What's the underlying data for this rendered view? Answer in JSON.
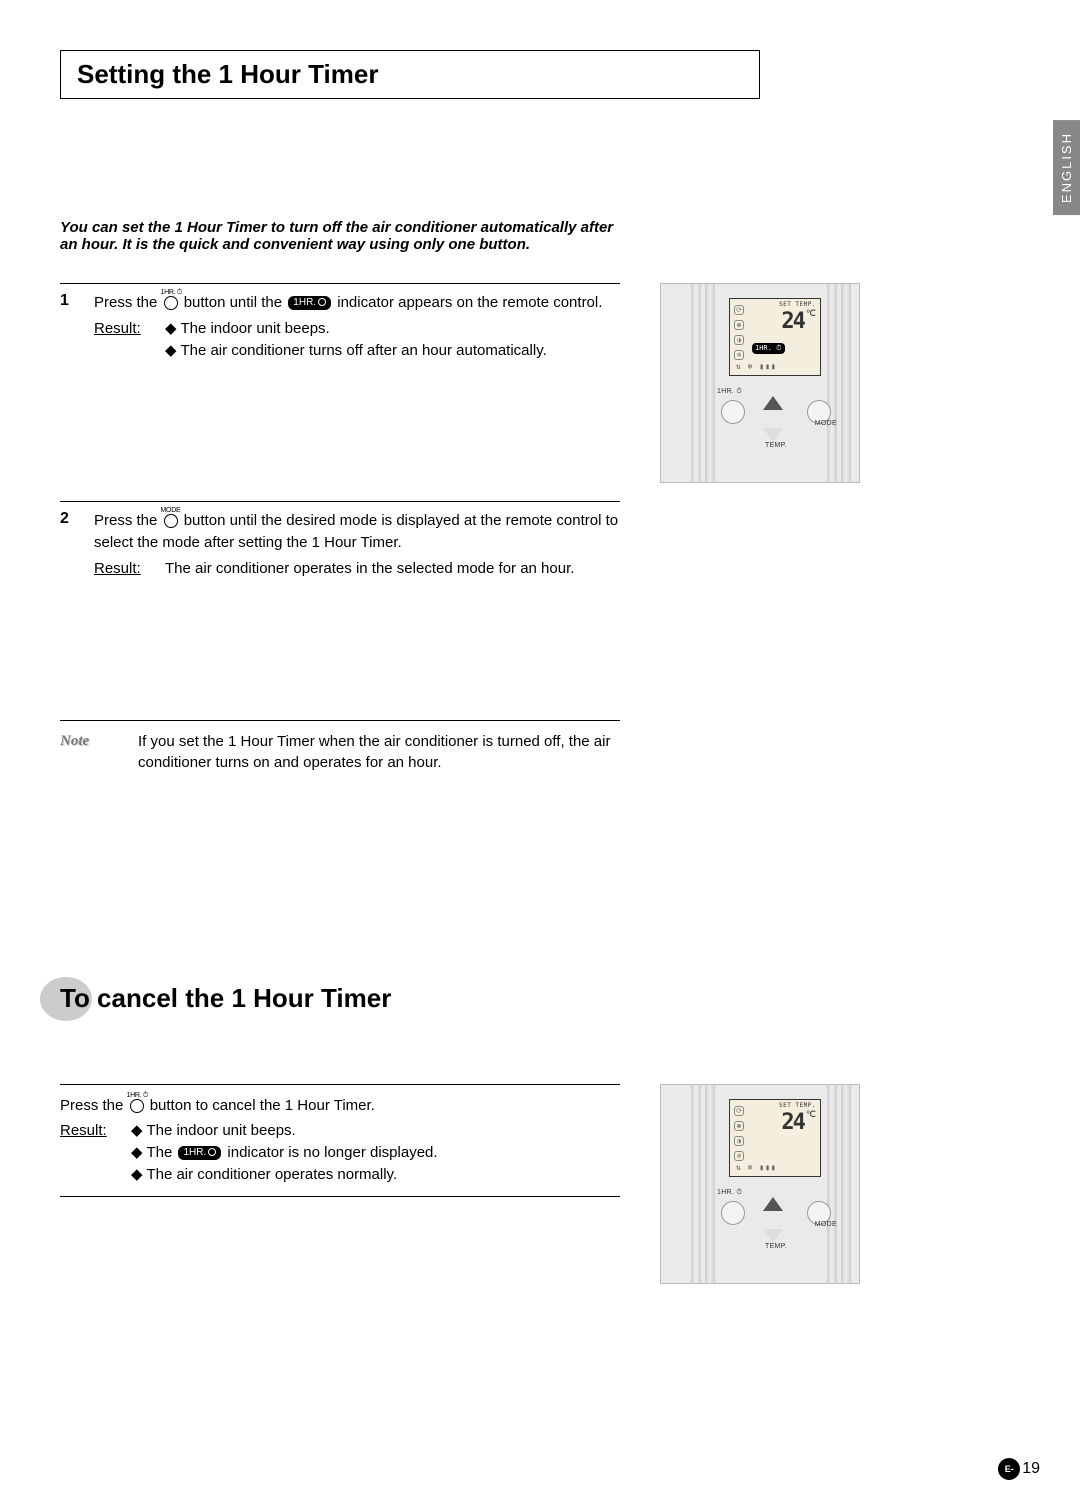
{
  "language_tab": "ENGLISH",
  "title": "Setting the 1 Hour Timer",
  "intro": "You can set the 1 Hour Timer to turn off the air conditioner automatically after an hour. It is the quick and convenient way using only one button.",
  "step1": {
    "num": "1",
    "btn_label": "1HR. ⏱",
    "badge": "1HR.",
    "text_before": "Press the ",
    "text_mid": " button until the ",
    "text_after": " indicator appears on the remote control.",
    "result_label": "Result:",
    "bullets": [
      "The indoor unit beeps.",
      "The air conditioner turns off after an hour automatically."
    ]
  },
  "step2": {
    "num": "2",
    "btn_label": "MODE",
    "text_before": "Press the ",
    "text_after": " button until the desired mode is displayed at the remote control to select the mode after setting the 1 Hour Timer.",
    "result_label": "Result:",
    "result_text": "The air conditioner operates in the selected mode for an hour."
  },
  "note": {
    "label": "Note",
    "text": "If you set the 1 Hour Timer when the air conditioner is turned off, the air conditioner turns on and operates for an hour."
  },
  "section2_title": "To cancel the 1 Hour Timer",
  "cancel": {
    "btn_label": "1HR. ⏱",
    "badge": "1HR.",
    "text_before": "Press the ",
    "text_after": " button to cancel the 1 Hour Timer.",
    "result_label": "Result:",
    "bullets_pre_badge": "The ",
    "bullets_post_badge": " indicator is no longer displayed.",
    "bullets": [
      "The indoor unit beeps.",
      "",
      "The air conditioner operates normally."
    ]
  },
  "remote": {
    "set_temp_label": "SET TEMP.",
    "temp_value": "24",
    "temp_unit": "℃",
    "hr_badge": "1HR. ⏱",
    "btn_hr_label": "1HR. ⏱",
    "btn_mode_label": "MODE",
    "btn_temp_label": "TEMP."
  },
  "page_number": {
    "prefix": "E-",
    "num": "19"
  }
}
